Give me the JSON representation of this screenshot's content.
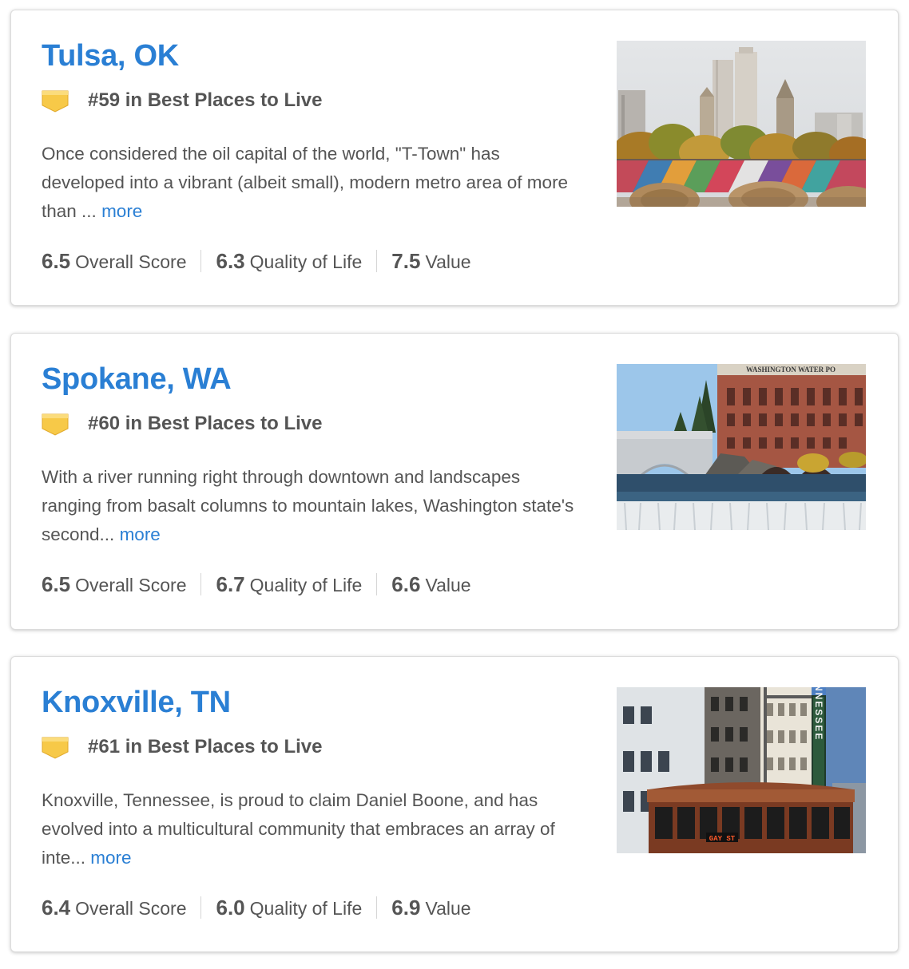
{
  "cities": [
    {
      "name": "Tulsa, OK",
      "rank": "#59 in Best Places to Live",
      "description": "Once considered the oil capital of the world, \"T-Town\" has developed into a vibrant (albeit small), modern metro area of more than ... ",
      "more": "more",
      "scores": [
        {
          "value": "6.5",
          "label": "Overall Score"
        },
        {
          "value": "6.3",
          "label": "Quality of Life"
        },
        {
          "value": "7.5",
          "label": "Value"
        }
      ]
    },
    {
      "name": "Spokane, WA",
      "rank": "#60 in Best Places to Live",
      "description": "With a river running right through downtown and landscapes ranging from basalt columns to mountain lakes, Washington state's second... ",
      "more": "more",
      "sign_text": "WASHINGTON WATER PO",
      "scores": [
        {
          "value": "6.5",
          "label": "Overall Score"
        },
        {
          "value": "6.7",
          "label": "Quality of Life"
        },
        {
          "value": "6.6",
          "label": "Value"
        }
      ]
    },
    {
      "name": "Knoxville, TN",
      "rank": "#61 in Best Places to Live",
      "description": "Knoxville, Tennessee, is proud to claim Daniel Boone, and has evolved into a multicultural community that embraces an array of inte... ",
      "more": "more",
      "sign_text": "TENNESSEE",
      "trolley_text": "GAY ST",
      "scores": [
        {
          "value": "6.4",
          "label": "Overall Score"
        },
        {
          "value": "6.0",
          "label": "Quality of Life"
        },
        {
          "value": "6.9",
          "label": "Value"
        }
      ]
    }
  ],
  "colors": {
    "title": "#2a7fd4",
    "link": "#2a7fd4",
    "text": "#555555",
    "badge": "#f7c948"
  },
  "icons": {
    "badge": "ribbon-badge-icon"
  }
}
